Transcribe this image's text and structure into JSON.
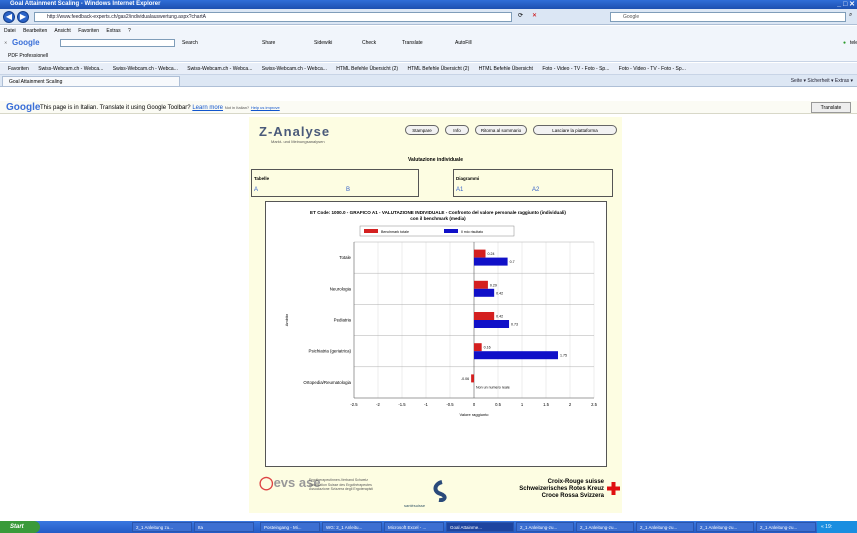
{
  "window": {
    "title": "Goal Attainment Scaling - Windows Internet Explorer"
  },
  "nav": {
    "url": "http://www.feedback-experts.ch/gas2/individualauswertung.aspx?chartA",
    "search_placeholder": "Google"
  },
  "menu": [
    "Datei",
    "Bearbeiten",
    "Ansicht",
    "Favoriten",
    "Extras",
    "?"
  ],
  "google_toolbar": {
    "label": "Google",
    "items": [
      "Search",
      "Share",
      "Sidewiki",
      "Check",
      "Translate",
      "AutoFill"
    ],
    "right": "telecor"
  },
  "pdf_toolbar": {
    "label": "PDF Professionell"
  },
  "favorites": {
    "label": "Favoriten",
    "items": [
      "Swiss-Webcam.ch - Webca...",
      "Swiss-Webcam.ch - Webca...",
      "Swiss-Webcam.ch - Webca...",
      "Swiss-Webcam.ch - Webca...",
      "HTML Befehle Übersicht (2)",
      "HTML Befehle Übersicht (2)",
      "HTML Befehle Übersicht",
      "Foto - Video - TV - Foto - Sp...",
      "Foto - Video - TV - Foto - Sp..."
    ]
  },
  "tab": {
    "label": "Goal Attainment Scaling",
    "tools": "Seite ▾   Sicherheit ▾   Extras ▾"
  },
  "translate_bar": {
    "logo": "Google",
    "message": "This page is in Italian.  Translate it using Google Toolbar?",
    "learn_more": "Learn more",
    "not_italian": "Not in Italian?",
    "help": "Help us improve",
    "button": "Translate"
  },
  "page": {
    "logo": "Z-Analyse",
    "logo_sub": "Markt- und Meinungsanalysen",
    "buttons": [
      "Stampare",
      "Info",
      "Ritorna al sommario",
      "Lasciare la piattaforma"
    ],
    "heading": "Valutazione individuale",
    "tables": {
      "title": "Tabelle",
      "links": [
        "A",
        "B"
      ]
    },
    "diagrams": {
      "title": "Diagrammi",
      "links": [
        "A1",
        "A2"
      ]
    }
  },
  "chart_data": {
    "type": "bar",
    "orientation": "horizontal",
    "title": "ET Code: 1000.0 - GRAFICO A1 - VALUTAZIONE INDIVIDUALE - Confronto del valore personale raggiunto (individuali) con il benchmark (media)",
    "xlabel": "Valore raggiunto",
    "ylabel": "Ambito",
    "xlim": [
      -2.5,
      2.5
    ],
    "xticks": [
      "-2.5",
      "-2",
      "-1.5",
      "-1",
      "-0.5",
      "0",
      "0.5",
      "1",
      "1.5",
      "2",
      "2.5"
    ],
    "categories": [
      "Totale",
      "Neurologia",
      "Pediatria",
      "Psichiatria (geriatrica)",
      "Ortopedia/Reumatologia"
    ],
    "series": [
      {
        "name": "Benchmark totale",
        "color": "#d42020",
        "values": [
          0.24,
          0.29,
          0.42,
          0.16,
          -0.06
        ],
        "labels": [
          "0.24",
          "0.29",
          "0.42",
          "0.16",
          "-0.06"
        ]
      },
      {
        "name": "Il mio risultato",
        "color": "#1010c8",
        "values": [
          0.7,
          0.42,
          0.73,
          1.75,
          null
        ],
        "labels": [
          "0.7",
          "0.42",
          "0.73",
          "1.75",
          "Non un numero reale"
        ]
      }
    ],
    "legend": "top-center",
    "grid": true
  },
  "footer": {
    "evs_logo": "evs ase",
    "evs_text": [
      "Ergotherapeutinnen-Verband Schweiz",
      "Association Suisse des Ergothérapeutes",
      "Associazione Svizzera degli Ergoterapisti"
    ],
    "sam_text": "santésuisse",
    "cr_text": [
      "Croix-Rouge suisse",
      "Schweizerisches Rotes Kreuz",
      "Croce Rossa Svizzera"
    ]
  },
  "taskbar": {
    "start": "Start",
    "tasks": [
      "2_1 Anleitung zu...",
      "Ita",
      "Posteingang - Mi...",
      "WG: 2_1 Anleitu...",
      "Microsoft Excel - ...",
      "Goal Attainme...",
      "2_1 Anleitung-zu...",
      "2_1 Anleitung-zu...",
      "2_1 Anleitung-zu...",
      "2_1 Anleitung-zu...",
      "2_1 Anleitung-zu...",
      "speichern_it - AC..."
    ],
    "clock": "« 19:"
  }
}
